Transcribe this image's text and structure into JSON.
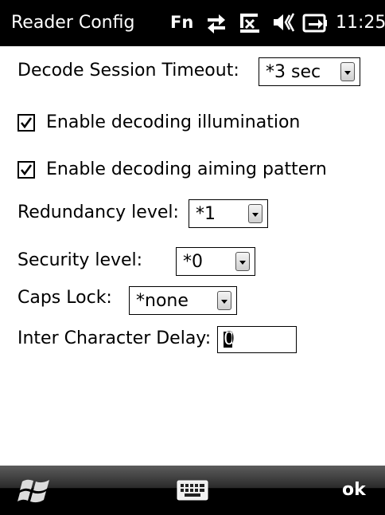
{
  "status_bar": {
    "title": "Reader Config",
    "fn_label": "Fn",
    "icons": [
      "data-connection-icon",
      "signal-icon",
      "speaker-icon",
      "battery-charging-icon"
    ],
    "time": "11:25"
  },
  "settings": {
    "decode_timeout": {
      "label": "Decode Session Timeout:",
      "value": "*3 sec"
    },
    "illumination": {
      "label": "Enable decoding illumination",
      "checked": true
    },
    "aiming": {
      "label": "Enable decoding aiming pattern",
      "checked": true
    },
    "redundancy": {
      "label": "Redundancy level:",
      "value": "*1"
    },
    "security": {
      "label": "Security level:",
      "value": "*0"
    },
    "caps_lock": {
      "label": "Caps Lock:",
      "value": "*none"
    },
    "inter_char_delay": {
      "label": "Inter Character Delay:",
      "value": "0"
    }
  },
  "menu_bar": {
    "start_icon": "windows-flag-icon",
    "keyboard_icon": "keyboard-icon",
    "ok_label": "OK"
  }
}
